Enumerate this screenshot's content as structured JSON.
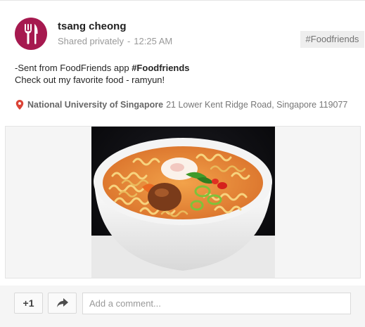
{
  "post": {
    "author": "tsang cheong",
    "visibility": "Shared privately",
    "time": "12:25 AM",
    "tag_chip": "#Foodfriends",
    "text_prefix": "-Sent from FoodFriends app ",
    "hashtag": "#Foodfriends",
    "text_line2": "Check out my favorite food - ramyun!",
    "location_name": "National University of Singapore",
    "location_address": "21 Lower Kent Ridge Road, Singapore 119077",
    "image_subject": "bowl-of-ramyun-noodles"
  },
  "actions": {
    "plus_one_label": "+1",
    "comment_placeholder": "Add a comment..."
  },
  "colors": {
    "avatar_bg": "#a6194f",
    "pin": "#db4437",
    "page_bg": "#f5f5f5"
  }
}
